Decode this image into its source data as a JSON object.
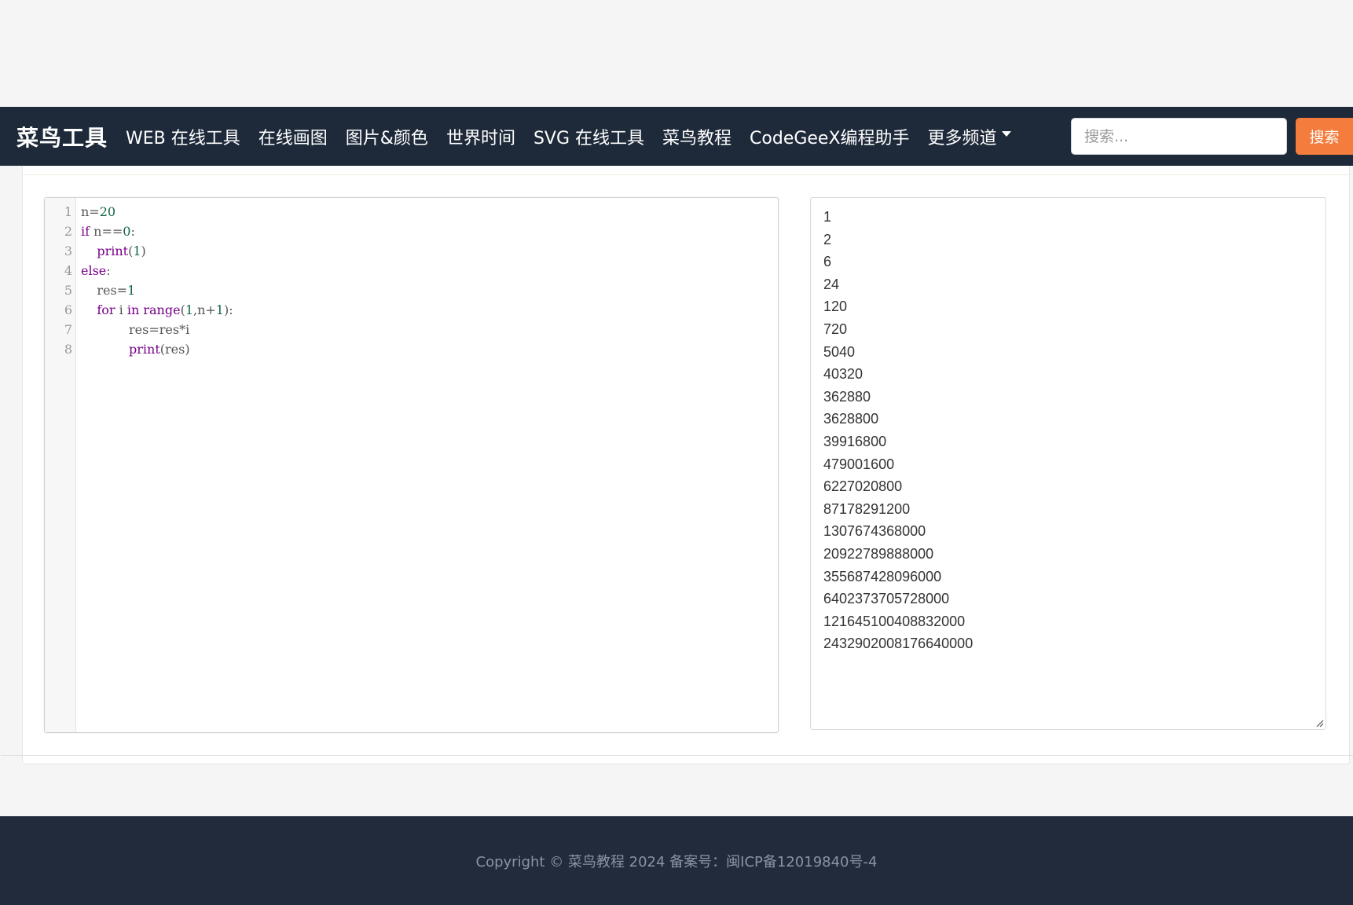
{
  "navbar": {
    "brand": "菜鸟工具",
    "items": [
      "WEB 在线工具",
      "在线画图",
      "图片&颜色",
      "世界时间",
      "SVG 在线工具",
      "菜鸟教程",
      "CodeGeeX编程助手"
    ],
    "more_label": "更多频道",
    "search_placeholder": "搜索...",
    "search_button": "搜索"
  },
  "editor": {
    "line_numbers": [
      "1",
      "2",
      "3",
      "4",
      "5",
      "6",
      "7",
      "8"
    ],
    "code_lines": [
      "n=20",
      "if n==0:",
      "    print(1)",
      "else:",
      "    res=1",
      "    for i in range(1,n+1):",
      "            res=res*i",
      "            print(res)"
    ]
  },
  "output": {
    "lines": [
      "1",
      "2",
      "6",
      "24",
      "120",
      "720",
      "5040",
      "40320",
      "362880",
      "3628800",
      "39916800",
      "479001600",
      "6227020800",
      "87178291200",
      "1307674368000",
      "20922789888000",
      "355687428096000",
      "6402373705728000",
      "121645100408832000",
      "2432902008176640000"
    ]
  },
  "footer": {
    "copyright": "Copyright © 菜鸟教程 2024 备案号：闽ICP备12019840号-4"
  },
  "colors": {
    "navbar_bg": "#1e2a3a",
    "search_button_bg": "#f47c3c",
    "footer_bg": "#222b3b"
  }
}
